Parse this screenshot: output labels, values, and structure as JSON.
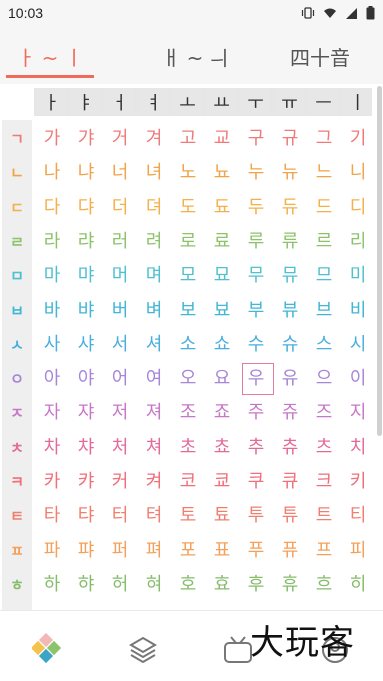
{
  "status": {
    "time": "10:03",
    "icons": [
      "vibrate-icon",
      "wifi-icon",
      "signal-icon",
      "battery-icon"
    ]
  },
  "tabs": [
    {
      "label": "ㅏ ~ ㅣ",
      "active": true
    },
    {
      "label": "ㅐ ~ ㅢ",
      "active": false
    },
    {
      "label": "四十音",
      "active": false
    }
  ],
  "vowels": [
    "ㅏ",
    "ㅑ",
    "ㅓ",
    "ㅕ",
    "ㅗ",
    "ㅛ",
    "ㅜ",
    "ㅠ",
    "ㅡ",
    "ㅣ"
  ],
  "rows": [
    {
      "label": "ㄱ",
      "color": "#ef7a7a",
      "syll": [
        "가",
        "갸",
        "거",
        "겨",
        "고",
        "교",
        "구",
        "규",
        "그",
        "기"
      ]
    },
    {
      "label": "ㄴ",
      "color": "#f0a348",
      "syll": [
        "나",
        "냐",
        "너",
        "녀",
        "노",
        "뇨",
        "누",
        "뉴",
        "느",
        "니"
      ]
    },
    {
      "label": "ㄷ",
      "color": "#f4b04a",
      "syll": [
        "다",
        "댜",
        "더",
        "뎌",
        "도",
        "됴",
        "두",
        "듀",
        "드",
        "디"
      ]
    },
    {
      "label": "ㄹ",
      "color": "#8cc36a",
      "syll": [
        "라",
        "랴",
        "러",
        "려",
        "로",
        "료",
        "루",
        "류",
        "르",
        "리"
      ]
    },
    {
      "label": "ㅁ",
      "color": "#4fc0cf",
      "syll": [
        "마",
        "먀",
        "머",
        "며",
        "모",
        "묘",
        "무",
        "뮤",
        "므",
        "미"
      ]
    },
    {
      "label": "ㅂ",
      "color": "#42b6d6",
      "syll": [
        "바",
        "뱌",
        "버",
        "벼",
        "보",
        "뵤",
        "부",
        "뷰",
        "브",
        "비"
      ]
    },
    {
      "label": "ㅅ",
      "color": "#4aaede",
      "syll": [
        "사",
        "샤",
        "서",
        "셔",
        "소",
        "쇼",
        "수",
        "슈",
        "스",
        "시"
      ]
    },
    {
      "label": "ㅇ",
      "color": "#a786d8",
      "syll": [
        "아",
        "야",
        "어",
        "여",
        "오",
        "요",
        "우",
        "유",
        "으",
        "이"
      ]
    },
    {
      "label": "ㅈ",
      "color": "#c777c8",
      "syll": [
        "자",
        "쟈",
        "저",
        "져",
        "조",
        "죠",
        "주",
        "쥬",
        "즈",
        "지"
      ]
    },
    {
      "label": "ㅊ",
      "color": "#e46a9a",
      "syll": [
        "차",
        "챠",
        "처",
        "쳐",
        "초",
        "쵸",
        "추",
        "츄",
        "츠",
        "치"
      ]
    },
    {
      "label": "ㅋ",
      "color": "#ef6f7a",
      "syll": [
        "카",
        "캬",
        "커",
        "켜",
        "코",
        "쿄",
        "쿠",
        "큐",
        "크",
        "키"
      ]
    },
    {
      "label": "ㅌ",
      "color": "#f07f70",
      "syll": [
        "타",
        "탸",
        "터",
        "텨",
        "토",
        "툐",
        "투",
        "튜",
        "트",
        "티"
      ]
    },
    {
      "label": "ㅍ",
      "color": "#f5a05a",
      "syll": [
        "파",
        "퍄",
        "퍼",
        "펴",
        "포",
        "표",
        "푸",
        "퓨",
        "프",
        "피"
      ]
    },
    {
      "label": "ㅎ",
      "color": "#86bd6c",
      "syll": [
        "하",
        "햐",
        "허",
        "혀",
        "호",
        "효",
        "후",
        "휴",
        "흐",
        "히"
      ]
    },
    {
      "label": "",
      "color": "#56bfa8",
      "syll": [
        "",
        "",
        "",
        "",
        "",
        "",
        "",
        "",
        "",
        ""
      ]
    }
  ],
  "selected": {
    "row": 7,
    "col": 6,
    "syllable": "우"
  },
  "bottom_nav": [
    {
      "name": "home-tab-icon",
      "active": true
    },
    {
      "name": "layers-tab-icon",
      "active": false
    },
    {
      "name": "tv-tab-icon",
      "active": false
    },
    {
      "name": "profile-tab-icon",
      "active": false
    }
  ],
  "watermark": "大玩客"
}
